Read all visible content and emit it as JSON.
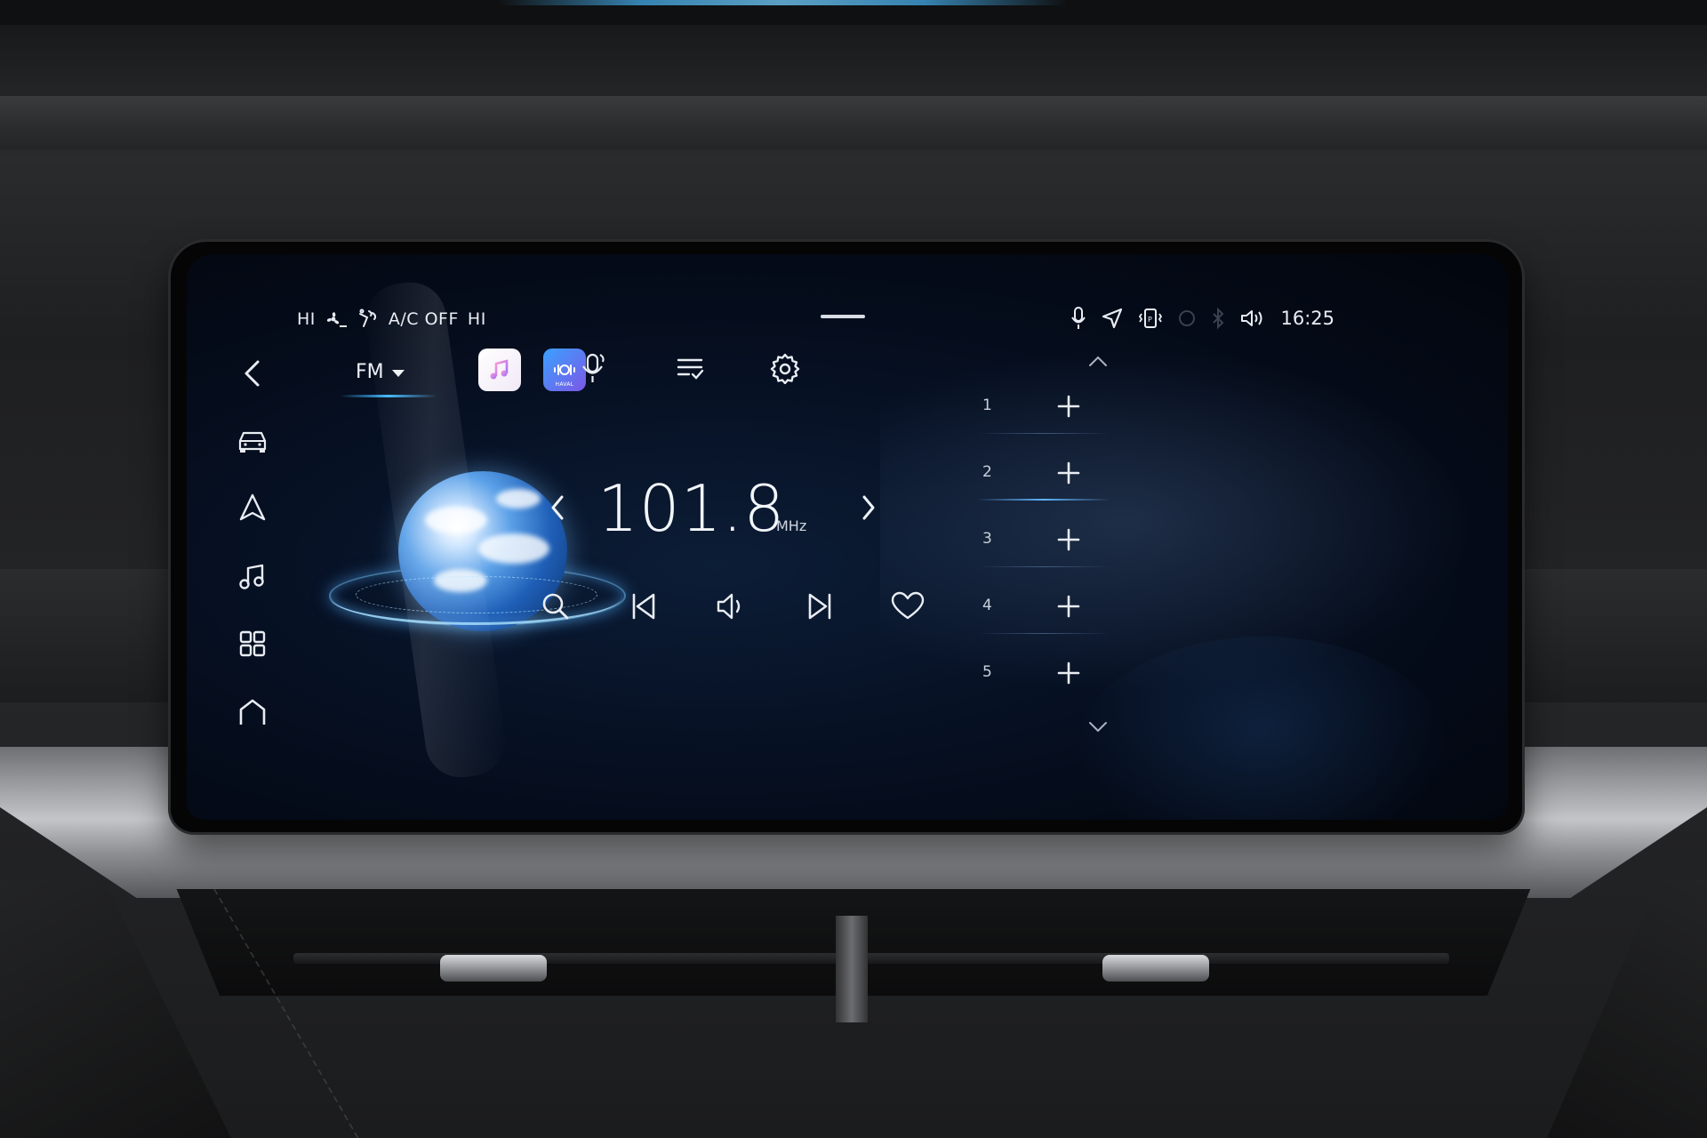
{
  "status_bar": {
    "fan_speed_left": "HI",
    "ac_status": "A/C OFF",
    "fan_speed_right": "HI",
    "time": "16:25"
  },
  "left_nav": {
    "items": [
      "back-icon",
      "car-icon",
      "navigation-icon",
      "music-icon",
      "apps-grid-icon",
      "home-icon"
    ]
  },
  "radio": {
    "band": "FM",
    "frequency": "101.8",
    "unit": "MHz",
    "sources": [
      "music-app-icon",
      "haval-audio-app-icon"
    ],
    "toolbar": [
      "voice-mic-icon",
      "station-list-icon",
      "settings-gear-icon"
    ],
    "controls": [
      "search-icon",
      "previous-track-icon",
      "volume-icon",
      "next-track-icon",
      "favorite-heart-icon"
    ],
    "brand_tile_text": "HAVAL"
  },
  "presets": {
    "items": [
      {
        "number": "1",
        "add_label": "+"
      },
      {
        "number": "2",
        "add_label": "+"
      },
      {
        "number": "3",
        "add_label": "+"
      },
      {
        "number": "4",
        "add_label": "+"
      },
      {
        "number": "5",
        "add_label": "+"
      }
    ]
  },
  "colors": {
    "accent": "#40b7ff",
    "text": "#eef2f7",
    "screen_bg": "#050b18"
  }
}
